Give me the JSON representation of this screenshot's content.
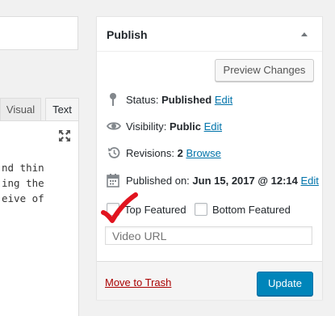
{
  "editor": {
    "tabs": {
      "visual": "Visual",
      "text": "Text"
    },
    "content_lines": [
      "nd thin",
      "ing the",
      "eive of"
    ]
  },
  "publish": {
    "title": "Publish",
    "preview_button": "Preview Changes",
    "status": {
      "label": "Status:",
      "value": "Published",
      "edit": "Edit"
    },
    "visibility": {
      "label": "Visibility:",
      "value": "Public",
      "edit": "Edit"
    },
    "revisions": {
      "label": "Revisions:",
      "value": "2",
      "browse": "Browse"
    },
    "published_on": {
      "label": "Published on:",
      "value": "Jun 15, 2017 @ 12:14",
      "edit": "Edit"
    },
    "checkboxes": [
      {
        "label": "Top Featured",
        "checked": false
      },
      {
        "label": "Bottom Featured",
        "checked": false
      }
    ],
    "video_url_placeholder": "Video URL",
    "move_to_trash": "Move to Trash",
    "update_button": "Update"
  },
  "colors": {
    "link": "#0073aa",
    "trash": "#aa0000",
    "primary": "#0085ba",
    "tick": "#e1141f"
  }
}
